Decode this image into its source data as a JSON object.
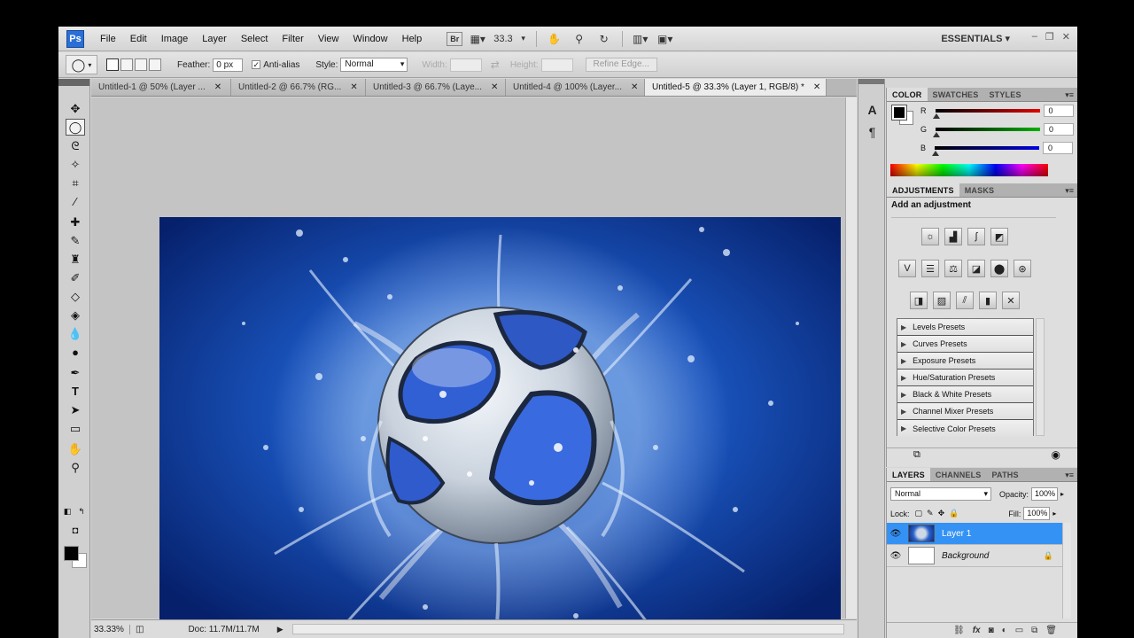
{
  "app": {
    "logo": "Ps",
    "menu": [
      "File",
      "Edit",
      "Image",
      "Layer",
      "Select",
      "Filter",
      "View",
      "Window",
      "Help"
    ],
    "bridge_label": "Br",
    "zoom_value": "33.3",
    "workspace": "ESSENTIALS",
    "window_controls": [
      "–",
      "❐",
      "✕"
    ]
  },
  "options": {
    "feather_label": "Feather:",
    "feather_value": "0 px",
    "antialias_label": "Anti-alias",
    "style_label": "Style:",
    "style_value": "Normal",
    "width_label": "Width:",
    "height_label": "Height:",
    "refine_edge": "Refine Edge..."
  },
  "tabs": [
    {
      "label": "Untitled-1 @ 50% (Layer ..."
    },
    {
      "label": "Untitled-2 @ 66.7% (RG..."
    },
    {
      "label": "Untitled-3 @ 66.7% (Laye..."
    },
    {
      "label": "Untitled-4 @ 100% (Layer..."
    },
    {
      "label": "Untitled-5 @ 33.3% (Layer 1, RGB/8) *"
    }
  ],
  "status": {
    "zoom": "33.33%",
    "doc": "Doc: 11.7M/11.7M"
  },
  "color_panel": {
    "tabs": [
      "COLOR",
      "SWATCHES",
      "STYLES"
    ],
    "channels": [
      {
        "label": "R",
        "value": "0",
        "color": "#e00000"
      },
      {
        "label": "G",
        "value": "0",
        "color": "#00b000"
      },
      {
        "label": "B",
        "value": "0",
        "color": "#0000e0"
      }
    ]
  },
  "adjustments": {
    "tabs": [
      "ADJUSTMENTS",
      "MASKS"
    ],
    "title": "Add an adjustment",
    "row1": [
      "brightness-icon",
      "levels-icon",
      "curves-icon",
      "exposure-icon"
    ],
    "row2": [
      "vibrance-icon",
      "hue-saturation-icon",
      "color-balance-icon",
      "black-white-icon",
      "photo-filter-icon",
      "channel-mixer-icon"
    ],
    "row3": [
      "invert-icon",
      "posterize-icon",
      "threshold-icon",
      "gradient-map-icon",
      "selective-color-icon"
    ],
    "presets": [
      "Levels Presets",
      "Curves Presets",
      "Exposure Presets",
      "Hue/Saturation Presets",
      "Black & White Presets",
      "Channel Mixer Presets",
      "Selective Color Presets"
    ]
  },
  "layers_panel": {
    "tabs": [
      "LAYERS",
      "CHANNELS",
      "PATHS"
    ],
    "blend_mode": "Normal",
    "opacity_label": "Opacity:",
    "opacity_value": "100%",
    "lock_label": "Lock:",
    "fill_label": "Fill:",
    "fill_value": "100%",
    "layers": [
      {
        "name": "Layer 1",
        "selected": true
      },
      {
        "name": "Background",
        "selected": false,
        "locked": true
      }
    ]
  }
}
